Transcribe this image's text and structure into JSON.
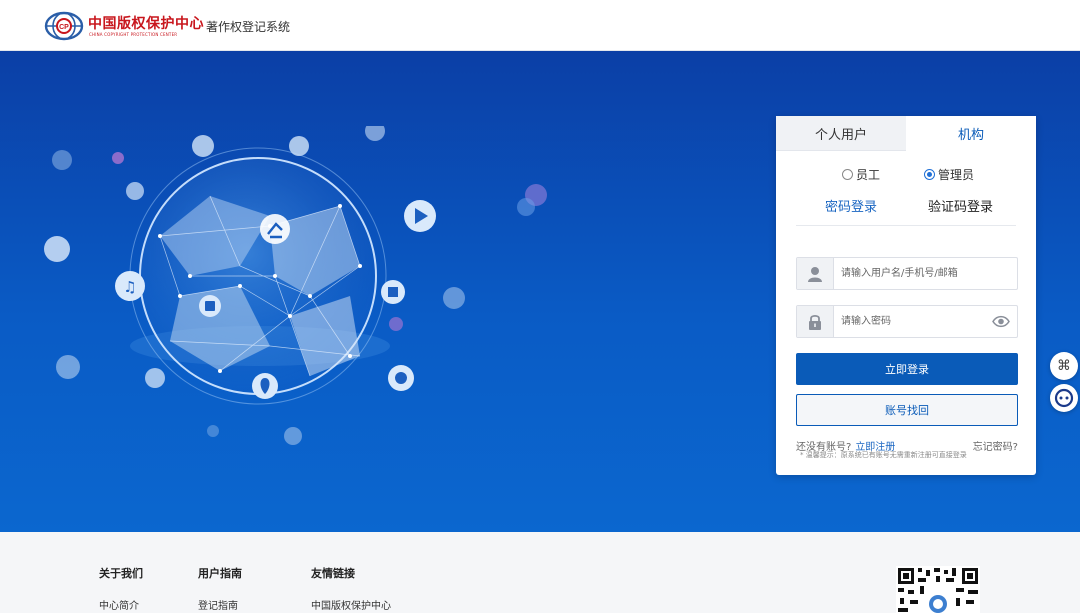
{
  "header": {
    "logo_cn": "中国版权保护中心",
    "logo_en": "CHINA COPYRIGHT PROTECTION CENTER",
    "system_name": "著作权登记系统"
  },
  "login": {
    "tabs": [
      {
        "label": "个人用户",
        "active": false
      },
      {
        "label": "机构",
        "active": true
      }
    ],
    "roles": [
      {
        "label": "员工",
        "selected": false
      },
      {
        "label": "管理员",
        "selected": true
      }
    ],
    "methods": [
      {
        "label": "密码登录",
        "active": false
      },
      {
        "label": "验证码登录",
        "active": true
      }
    ],
    "username_placeholder": "请输入用户名/手机号/邮箱",
    "password_placeholder": "请输入密码",
    "login_button": "立即登录",
    "recover_button": "账号找回",
    "no_account": "还没有账号?",
    "register_link": "立即注册",
    "forgot_link": "忘记密码?",
    "tip": "* 温馨提示：原系统已有账号无需重新注册可直接登录"
  },
  "colors": {
    "brand_red": "#c8161d",
    "primary_blue": "#0a5bb8",
    "hero_top": "#0b3fa6",
    "hero_bottom": "#0b67cf"
  },
  "floating": [
    {
      "icon": "command-icon"
    },
    {
      "icon": "chat-bot-icon"
    }
  ],
  "footer": {
    "columns": [
      {
        "title": "关于我们",
        "items": [
          "中心简介"
        ]
      },
      {
        "title": "用户指南",
        "items": [
          "登记指南"
        ]
      },
      {
        "title": "友情链接",
        "items": [
          "中国版权保护中心"
        ]
      }
    ]
  }
}
